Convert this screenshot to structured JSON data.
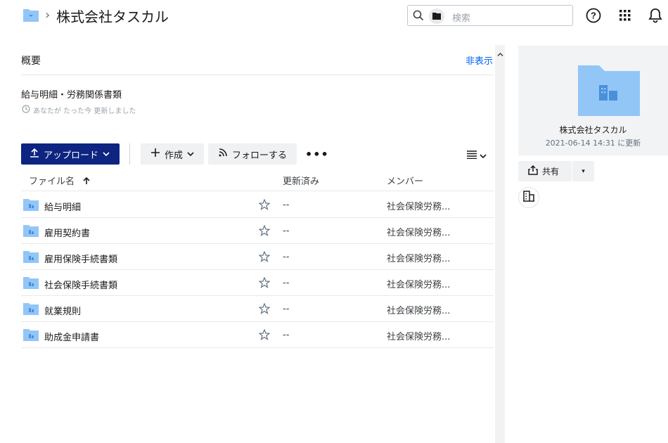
{
  "header": {
    "title": "株式会社タスカル",
    "separator": "›",
    "search_placeholder": "検索"
  },
  "overview": {
    "title": "概要",
    "hide_label": "非表示",
    "doc_title": "給与明細・労務関係書類",
    "meta": "あなたが たった今 更新しました"
  },
  "toolbar": {
    "upload_label": "アップロード",
    "create_label": "作成",
    "follow_label": "フォローする",
    "more_label": "•••"
  },
  "table": {
    "col_name": "ファイル名",
    "col_updated": "更新済み",
    "col_members": "メンバー",
    "rows": [
      {
        "name": "給与明細",
        "updated": "--",
        "members": "社会保険労務..."
      },
      {
        "name": "雇用契約書",
        "updated": "--",
        "members": "社会保険労務..."
      },
      {
        "name": "雇用保険手続書類",
        "updated": "--",
        "members": "社会保険労務..."
      },
      {
        "name": "社会保険手続書類",
        "updated": "--",
        "members": "社会保険労務..."
      },
      {
        "name": "就業規則",
        "updated": "--",
        "members": "社会保険労務..."
      },
      {
        "name": "助成金申請書",
        "updated": "--",
        "members": "社会保険労務..."
      }
    ]
  },
  "sidebar": {
    "folder_name": "株式会社タスカル",
    "updated": "2021-06-14 14:31 に更新",
    "share_label": "共有",
    "share_dropdown": "▾"
  },
  "colors": {
    "accent": "#0d2481",
    "folder": "#92c6f7",
    "link": "#0061fe"
  }
}
